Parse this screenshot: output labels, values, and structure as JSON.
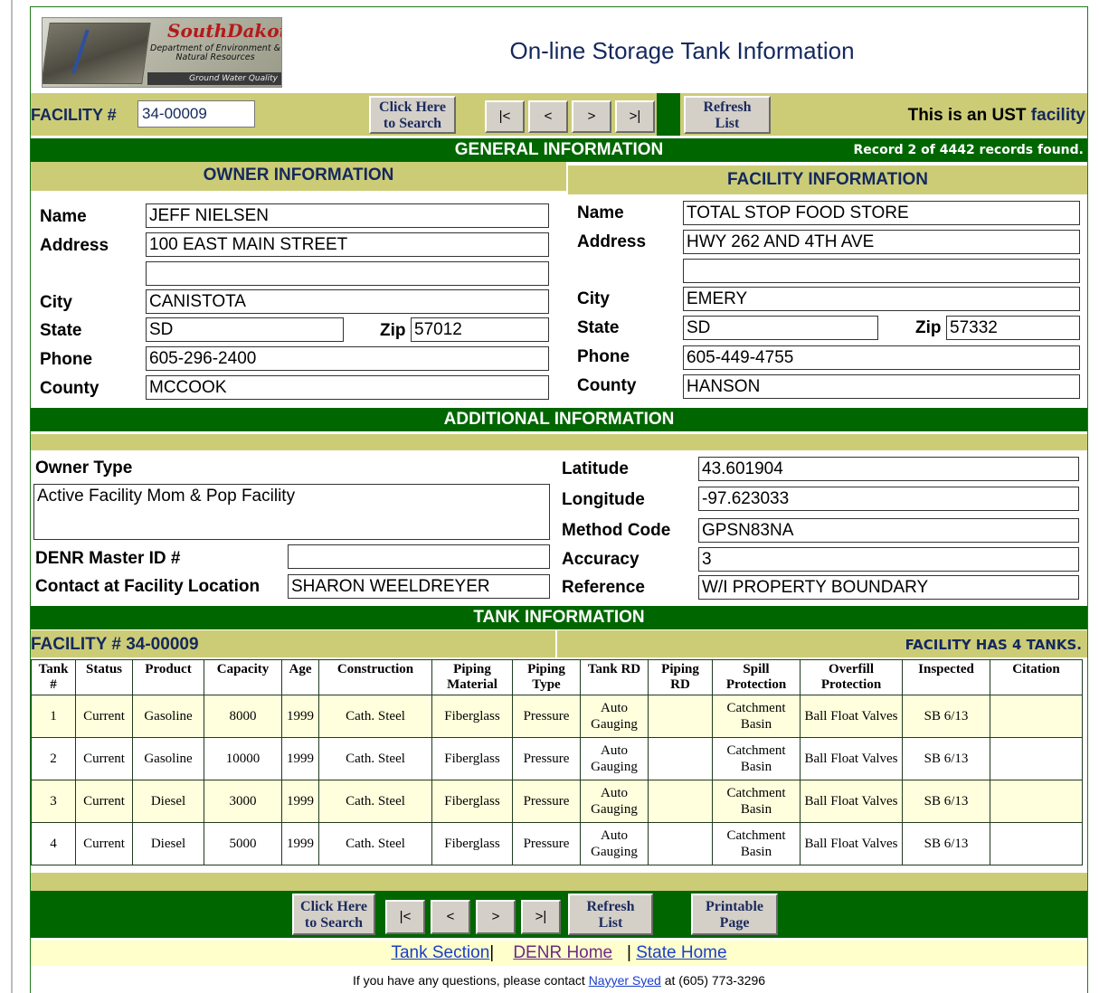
{
  "header": {
    "logo_script": "SouthDakota",
    "logo_dept": "Department of Environment & Natural Resources",
    "logo_gwq": "Ground Water Quality",
    "title": "On-line Storage Tank Information"
  },
  "nav": {
    "facility_label": "FACILITY #",
    "facility_value": "34-00009",
    "search_btn": [
      "Click Here",
      "to Search"
    ],
    "first_btn": "|<",
    "prev_btn": "<",
    "next_btn": ">",
    "last_btn": ">|",
    "refresh_btn": [
      "Refresh",
      "List"
    ],
    "status_prefix": "This is an UST ",
    "status_suffix": "facility"
  },
  "general": {
    "title": "GENERAL INFORMATION",
    "record": "Record 2 of 4442 records found."
  },
  "owner": {
    "heading": "OWNER INFORMATION",
    "name_label": "Name",
    "name": "JEFF NIELSEN",
    "address_label": "Address",
    "address1": "100 EAST MAIN STREET",
    "address2": "",
    "city_label": "City",
    "city": "CANISTOTA",
    "state_label": "State",
    "state": "SD",
    "zip_label": "Zip",
    "zip": "57012",
    "phone_label": "Phone",
    "phone": "605-296-2400",
    "county_label": "County",
    "county": "MCCOOK"
  },
  "facility": {
    "heading": "FACILITY INFORMATION",
    "name_label": "Name",
    "name": "TOTAL STOP FOOD STORE",
    "address_label": "Address",
    "address1": "HWY 262 AND 4TH AVE",
    "address2": "",
    "city_label": "City",
    "city": "EMERY",
    "state_label": "State",
    "state": "SD",
    "zip_label": "Zip",
    "zip": "57332",
    "phone_label": "Phone",
    "phone": "605-449-4755",
    "county_label": "County",
    "county": "HANSON"
  },
  "additional": {
    "title": "ADDITIONAL INFORMATION",
    "owner_type_label": "Owner Type",
    "owner_type": "Active Facility Mom & Pop Facility",
    "master_id_label": "DENR Master ID #",
    "master_id": "",
    "contact_label": "Contact at Facility Location",
    "contact": "SHARON WEELDREYER",
    "latitude_label": "Latitude",
    "latitude": "43.601904",
    "longitude_label": "Longitude",
    "longitude": "-97.623033",
    "method_label": "Method Code",
    "method": "GPSN83NA",
    "accuracy_label": "Accuracy",
    "accuracy": "3",
    "reference_label": "Reference",
    "reference": "W/I PROPERTY BOUNDARY"
  },
  "tanks": {
    "title": "TANK INFORMATION",
    "facility_line": "FACILITY # 34-00009",
    "count_line": "FACILITY HAS 4 TANKS.",
    "headers": [
      "Tank #",
      "Status",
      "Product",
      "Capacity",
      "Age",
      "Construction",
      "Piping Material",
      "Piping Type",
      "Tank RD",
      "Piping RD",
      "Spill Protection",
      "Overfill Protection",
      "Inspected",
      "Citation"
    ],
    "rows": [
      [
        "1",
        "Current",
        "Gasoline",
        "8000",
        "1999",
        "Cath. Steel",
        "Fiberglass",
        "Pressure",
        "Auto Gauging",
        "",
        "Catchment Basin",
        "Ball Float Valves",
        "SB 6/13",
        ""
      ],
      [
        "2",
        "Current",
        "Gasoline",
        "10000",
        "1999",
        "Cath. Steel",
        "Fiberglass",
        "Pressure",
        "Auto Gauging",
        "",
        "Catchment Basin",
        "Ball Float Valves",
        "SB 6/13",
        ""
      ],
      [
        "3",
        "Current",
        "Diesel",
        "3000",
        "1999",
        "Cath. Steel",
        "Fiberglass",
        "Pressure",
        "Auto Gauging",
        "",
        "Catchment Basin",
        "Ball Float Valves",
        "SB 6/13",
        ""
      ],
      [
        "4",
        "Current",
        "Diesel",
        "5000",
        "1999",
        "Cath. Steel",
        "Fiberglass",
        "Pressure",
        "Auto Gauging",
        "",
        "Catchment Basin",
        "Ball Float Valves",
        "SB 6/13",
        ""
      ]
    ]
  },
  "bottom_nav": {
    "search_btn": [
      "Click Here",
      "to Search"
    ],
    "first_btn": "|<",
    "prev_btn": "<",
    "next_btn": ">",
    "last_btn": ">|",
    "refresh_btn": [
      "Refresh",
      "List"
    ],
    "print_btn": [
      "Printable",
      "Page"
    ]
  },
  "footer": {
    "link_tank": "Tank Section",
    "sep1": "|",
    "link_denr": "DENR Home",
    "sep2": "|",
    "link_state": "State Home",
    "contact_prefix": "If you have any questions, please contact ",
    "contact_name": "Nayyer Syed",
    "contact_suffix": " at (605) 773-3296"
  },
  "colors": {
    "dark_green": "#006600",
    "tan": "#cccc77",
    "cream": "#ffffdd",
    "title_blue": "#14285e"
  }
}
